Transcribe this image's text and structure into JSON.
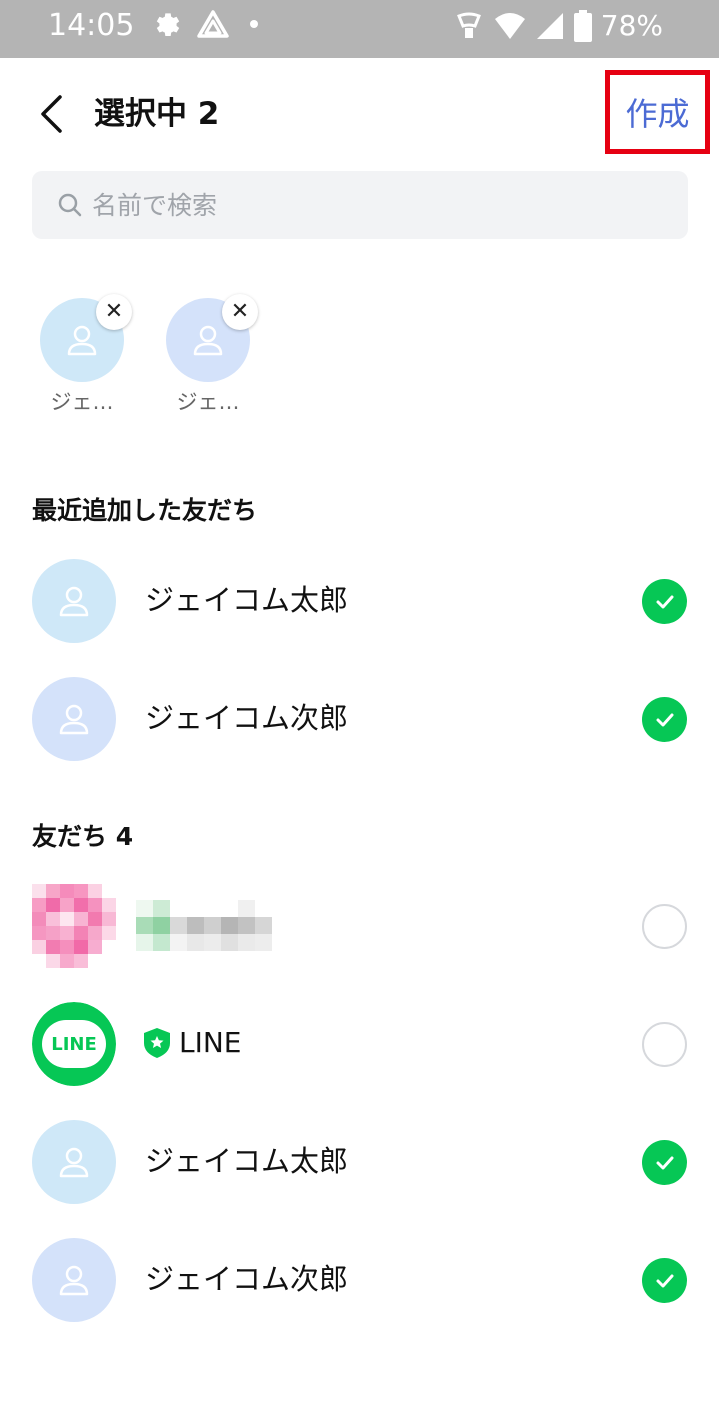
{
  "status_bar": {
    "time": "14:05",
    "battery": "78%",
    "icons": [
      "gear-icon",
      "drive-icon",
      "dot",
      "nfc-icon",
      "wifi-icon",
      "signal-icon",
      "battery-icon"
    ]
  },
  "header": {
    "title": "選択中 2",
    "create_label": "作成",
    "back_icon": "chevron-left-icon"
  },
  "search": {
    "placeholder": "名前で検索",
    "icon": "search-icon"
  },
  "selected": [
    {
      "name": "ジェ…",
      "avatar_color": "#cfe8f8"
    },
    {
      "name": "ジェ…",
      "avatar_color": "#d4e2fa"
    }
  ],
  "recent": {
    "title": "最近追加した友だち",
    "items": [
      {
        "name": "ジェイコム太郎",
        "checked": true,
        "avatar_color": "#cfe8f8"
      },
      {
        "name": "ジェイコム次郎",
        "checked": true,
        "avatar_color": "#d4e2fa"
      }
    ]
  },
  "friends": {
    "title": "友だち 4",
    "items": [
      {
        "name": "",
        "checked": false,
        "avatar": "mosaic"
      },
      {
        "name": "LINE",
        "checked": false,
        "avatar": "line-logo",
        "badge": "official-shield-icon"
      },
      {
        "name": "ジェイコム太郎",
        "checked": true,
        "avatar_color": "#cfe8f8"
      },
      {
        "name": "ジェイコム次郎",
        "checked": true,
        "avatar_color": "#d4e2fa"
      }
    ]
  },
  "colors": {
    "accent_blue": "#4c6bd4",
    "check_green": "#06c755",
    "highlight_red": "#e60012",
    "statusbar_gray": "#b4b4b4"
  }
}
